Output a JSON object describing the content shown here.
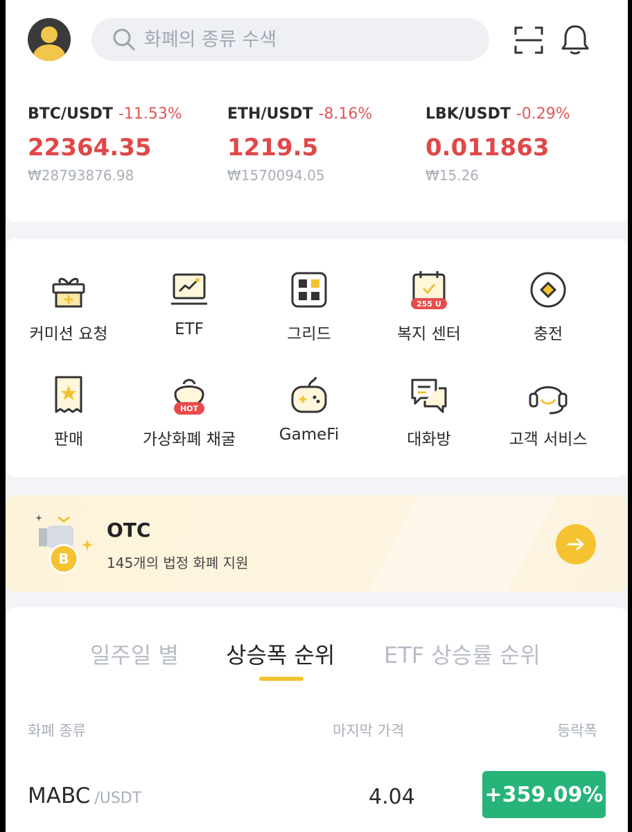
{
  "search": {
    "placeholder": "화폐의 종류 수색"
  },
  "tickers": [
    {
      "pair": "BTC/USDT",
      "change": "-11.53%",
      "price": "22364.35",
      "krw": "₩28793876.98"
    },
    {
      "pair": "ETH/USDT",
      "change": "-8.16%",
      "price": "1219.5",
      "krw": "₩1570094.05"
    },
    {
      "pair": "LBK/USDT",
      "change": "-0.29%",
      "price": "0.011863",
      "krw": "₩15.26"
    }
  ],
  "shortcuts": [
    {
      "label": "커미션 요청",
      "icon": "gift-icon"
    },
    {
      "label": "ETF",
      "icon": "chart-monitor-icon"
    },
    {
      "label": "그리드",
      "icon": "grid-icon"
    },
    {
      "label": "복지 센터",
      "icon": "calendar-reward-icon",
      "badge": "255 U"
    },
    {
      "label": "충전",
      "icon": "deposit-icon"
    },
    {
      "label": "판매",
      "icon": "receipt-icon"
    },
    {
      "label": "가상화폐 채굴",
      "icon": "mining-icon",
      "badge": "HOT"
    },
    {
      "label": "GameFi",
      "icon": "gamepad-icon"
    },
    {
      "label": "대화방",
      "icon": "chat-icon"
    },
    {
      "label": "고객 서비스",
      "icon": "headset-icon"
    }
  ],
  "otc": {
    "title": "OTC",
    "subtitle": "145개의 법정 화폐 지원"
  },
  "ranking": {
    "tabs": [
      "일주일 별",
      "상승폭 순위",
      "ETF 상승률 순위"
    ],
    "active_tab": 1,
    "columns": {
      "name": "화폐 종류",
      "price": "마지막 가격",
      "change": "등락폭"
    },
    "rows": [
      {
        "base": "MABC",
        "quote": "/USDT",
        "price": "4.04",
        "change": "+359.09%"
      }
    ]
  },
  "colors": {
    "accent": "#f2c230",
    "down": "#e04848",
    "up": "#27b479"
  }
}
